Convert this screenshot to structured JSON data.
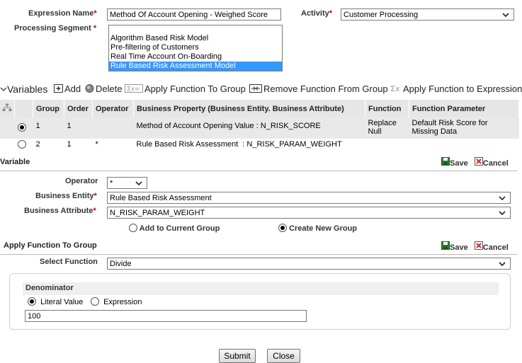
{
  "expression": {
    "name_label": "Expression Name",
    "name_value": "Method Of Account Opening - Weighed Score",
    "activity_label": "Activity",
    "activity_value": "Customer Processing",
    "segment_label": "Processing Segment",
    "segments": [
      "Algorithm Based Risk Model",
      "Pre-filtering of Customers",
      "Real Time Account On-Boarding",
      "Rule Based Risk Assessment Model"
    ],
    "selected_segment_index": 3
  },
  "toolbar": {
    "variables": "Variables",
    "add": "Add",
    "delete": "Delete",
    "apply_group": "Apply Function To Group",
    "remove_group": "Remove Function From Group",
    "apply_expr": "Apply Function to Expression"
  },
  "grid": {
    "headers": [
      "Group",
      "Order",
      "Operator",
      "Business Property (Business Entity. Business Attribute)",
      "Function",
      "Function Parameter"
    ],
    "rows": [
      {
        "group": "1",
        "order": "1",
        "operator": "",
        "property": "Method of Account Opening Value : N_RISK_SCORE",
        "function": "Replace Null",
        "param": "Default Risk Score for Missing Data"
      },
      {
        "group": "2",
        "order": "1",
        "operator": "*",
        "property": "Rule Based Risk Assessment  : N_RISK_PARAM_WEIGHT",
        "function": "",
        "param": ""
      }
    ]
  },
  "variable": {
    "title": "Variable",
    "save": "Save",
    "cancel": "Cancel",
    "operator_label": "Operator",
    "operator_value": "*",
    "entity_label": "Business Entity",
    "entity_value": "Rule Based Risk Assessment",
    "attribute_label": "Business Attribute",
    "attribute_value": "N_RISK_PARAM_WEIGHT",
    "add_current": "Add to Current Group",
    "create_new": "Create New Group"
  },
  "apply_group": {
    "title": "Apply Function To Group",
    "save": "Save",
    "cancel": "Cancel",
    "select_function_label": "Select Function",
    "select_function_value": "Divide",
    "denominator_label": "Denominator",
    "literal": "Literal Value",
    "expression": "Expression",
    "value": "100"
  },
  "buttons": {
    "submit": "Submit",
    "close": "Close"
  }
}
